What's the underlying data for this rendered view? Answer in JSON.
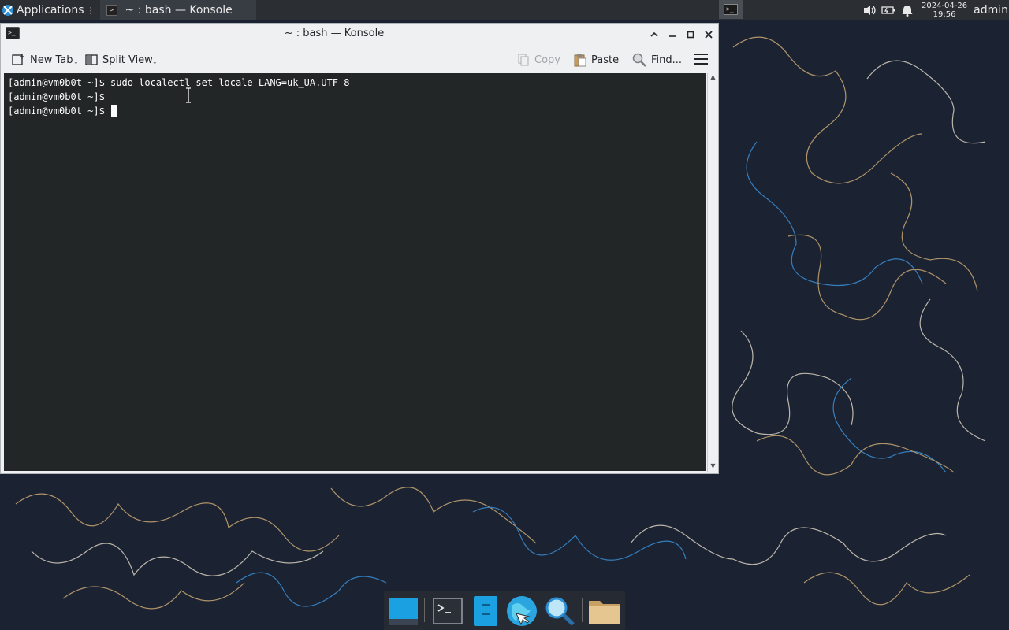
{
  "panel": {
    "applications_label": "Applications",
    "task_title": "~ : bash — Konsole",
    "clock_date": "2024-04-26",
    "clock_time": "19:56",
    "user": "admin"
  },
  "window": {
    "title": "~ : bash — Konsole",
    "toolbar": {
      "new_tab": "New Tab",
      "split_view": "Split View",
      "copy": "Copy",
      "paste": "Paste",
      "find": "Find..."
    }
  },
  "terminal": {
    "lines": [
      "[admin@vm0b0t ~]$ sudo localectl set-locale LANG=uk_UA.UTF-8",
      "[admin@vm0b0t ~]$",
      "[admin@vm0b0t ~]$ "
    ]
  },
  "dock": {
    "items": [
      "show-desktop",
      "terminal",
      "file-manager-sidebar",
      "web-browser",
      "app-finder",
      "files-folder"
    ]
  },
  "colors": {
    "panel_bg": "#2b2e33",
    "terminal_bg": "#232627",
    "window_bg": "#eff0f1",
    "wallpaper_bg": "#1b2333"
  }
}
